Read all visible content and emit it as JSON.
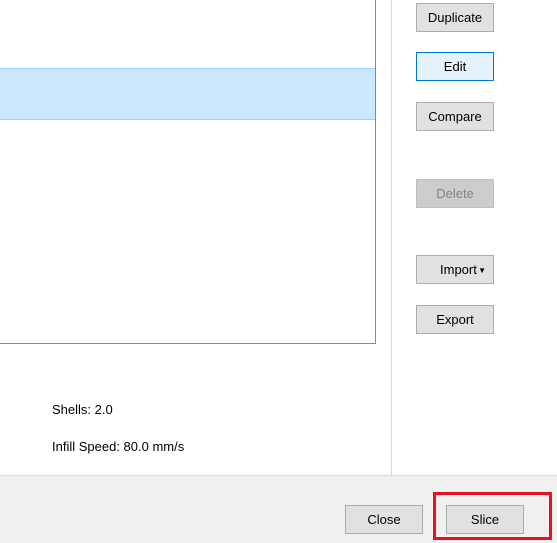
{
  "list": {
    "rows": [
      {
        "label": "",
        "selected": true
      }
    ]
  },
  "buttons": {
    "duplicate": "Duplicate",
    "edit": "Edit",
    "compare": "Compare",
    "delete": "Delete",
    "import": "Import",
    "export": "Export"
  },
  "details": {
    "shells": "Shells: 2.0",
    "infill_speed": "Infill Speed: 80.0 mm/s"
  },
  "footer": {
    "close": "Close",
    "slice": "Slice"
  },
  "icons": {
    "import_dropdown": "caret-down-icon"
  },
  "colors": {
    "selection": "#cce8ff",
    "focus_border": "#0078d7",
    "highlight": "#e81123"
  }
}
